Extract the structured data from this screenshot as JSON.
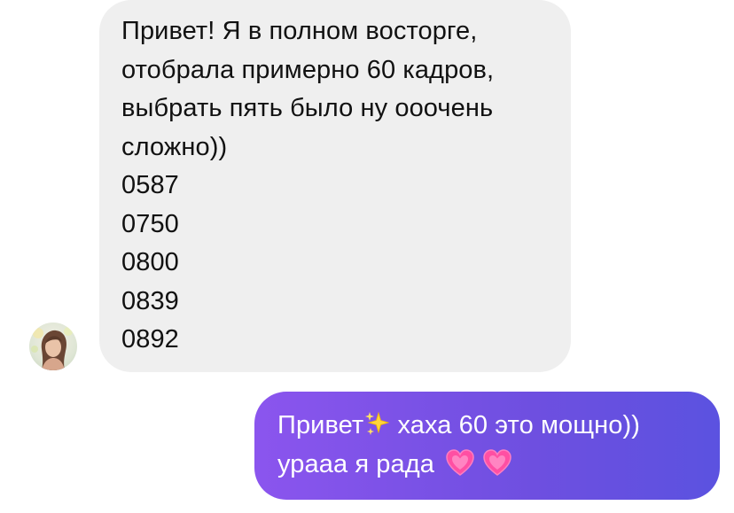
{
  "incoming_message": {
    "lines": [
      "Привет! Я в полном восторге,",
      "отобрала примерно 60 кадров,",
      "выбрать пять было ну ооочень",
      "сложно))",
      "0587",
      "0750",
      "0800",
      "0839",
      "0892"
    ]
  },
  "outgoing_message": {
    "line1_before": "Привет",
    "line1_after": " хаха 60 это мощно))",
    "line2": "урааа я рада ",
    "emojis": [
      "sparkles-icon",
      "growing-heart-icon",
      "growing-heart-icon"
    ]
  },
  "colors": {
    "incoming_bubble": "#efefef",
    "outgoing_gradient_start": "#8b55ee",
    "outgoing_gradient_end": "#5b52e0"
  }
}
